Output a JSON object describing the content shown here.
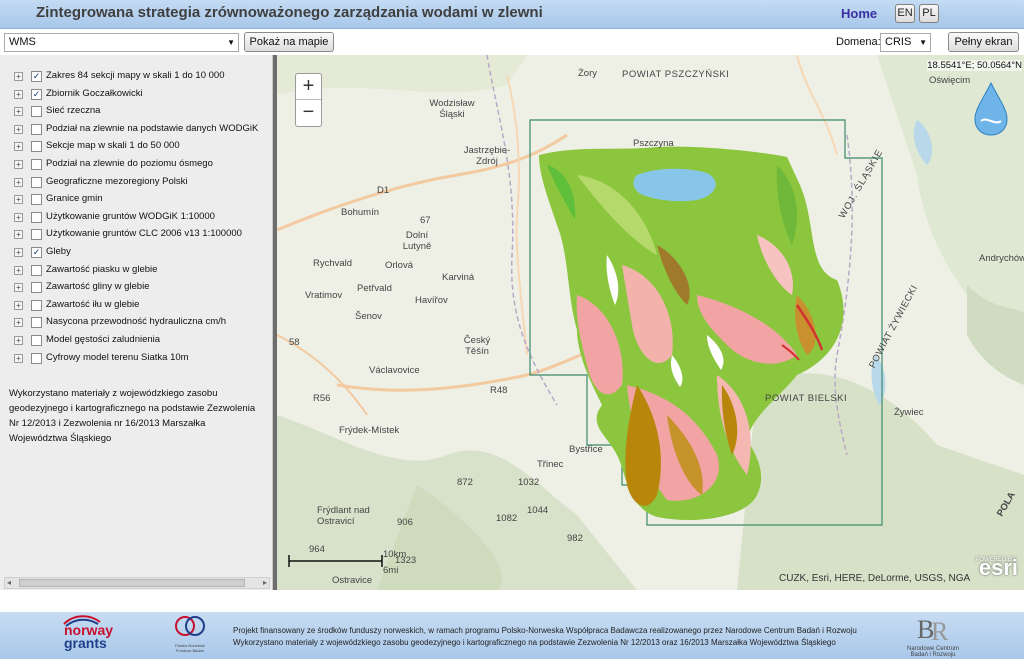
{
  "header": {
    "title": "Zintegrowana strategia zrównoważonego zarządzania wodami w zlewni",
    "home_label": "Home",
    "lang_en": "EN",
    "lang_pl": "PL"
  },
  "toolbar": {
    "service_select": "WMS",
    "show_on_map": "Pokaż na mapie",
    "domain_label": "Domena:",
    "domain_select": "CRIS",
    "fullscreen": "Pełny ekran"
  },
  "layers": [
    {
      "label": "Zakres 84 sekcji mapy w skali 1 do 10 000",
      "checked": true
    },
    {
      "label": "Zbiornik Goczałkowicki",
      "checked": true
    },
    {
      "label": "Sieć rzeczna",
      "checked": false
    },
    {
      "label": "Podział na zlewnie na podstawie danych WODGiK",
      "checked": false
    },
    {
      "label": "Sekcje map w skali 1 do 50 000",
      "checked": false
    },
    {
      "label": "Podział na zlewnie do poziomu ósmego",
      "checked": false
    },
    {
      "label": "Geograficzne mezoregiony Polski",
      "checked": false
    },
    {
      "label": "Granice gmin",
      "checked": false
    },
    {
      "label": "Użytkowanie gruntów WODGiK 1:10000",
      "checked": false
    },
    {
      "label": "Użytkowanie gruntów CLC 2006 v13 1:100000",
      "checked": false
    },
    {
      "label": "Gleby",
      "checked": true
    },
    {
      "label": "Zawartość piasku w glebie",
      "checked": false
    },
    {
      "label": "Zawartość gliny w glebie",
      "checked": false
    },
    {
      "label": "Zawartość iłu w glebie",
      "checked": false
    },
    {
      "label": "Nasycona przewodność hydrauliczna cm/h",
      "checked": false
    },
    {
      "label": "Model gęstości zaludnienia",
      "checked": false
    },
    {
      "label": "Cyfrowy model terenu Siatka 10m",
      "checked": false
    }
  ],
  "sidebar": {
    "credit": "Wykorzystano materiały z wojewódzkiego zasobu geodezyjnego i kartograficznego na podstawie Zezwolenia Nr 12/2013 i Zezwolenia nr 16/2013 Marszałka Województwa Śląskiego"
  },
  "map": {
    "coords": "18.5541°E; 50.0564°N",
    "zoom_in": "+",
    "zoom_out": "−",
    "attribution": "CUZK, Esri, HERE, DeLorme, USGS, NGA",
    "esri": "esri",
    "powered_by": "POWERED BY",
    "scale_km": "10km",
    "scale_mi": "6mi",
    "places": [
      "Żory",
      "POWIAT PSZCZYŃSKI",
      "Oświęcim",
      "Wodzisław Śląski",
      "Jastrzębie-Zdrój",
      "Pszczyna",
      "Bohumín",
      "Dolní Lutyně",
      "Rychvald",
      "Orlová",
      "Karviná",
      "Petřvald",
      "Havířov",
      "Vratimov",
      "Šenov",
      "Český Těšín",
      "Václavovice",
      "Frýdek-Místek",
      "Bystřice",
      "Třinec",
      "Frýdlant nad Ostravicí",
      "Żywiec",
      "POWIAT BIELSKI",
      "WOJ. ŚLĄSKIE",
      "POWIAT ŻYWIECKI",
      "Andrychów",
      "Ostravice",
      "R48",
      "R56",
      "D1",
      "67",
      "58",
      "872",
      "1032",
      "1082",
      "1044",
      "982",
      "906",
      "964",
      "1323",
      "POLA"
    ]
  },
  "footer": {
    "norway_line1": "norway",
    "norway_line2": "grants",
    "partner_label": "Polsko-Norweski Fundusz Badań",
    "ncbr_label": "Narodowe Centrum Badań i Rozwoju",
    "text_line1": "Projekt finansowany ze środków funduszy norweskich, w ramach programu Polsko-Norweska Współpraca Badawcza realizowanego przez Narodowe Centrum Badań i Rozwoju",
    "text_line2": "Wykorzystano materiały z wojewódzkiego zasobu geodezyjnego i kartograficznego na podstawie Zezwolenia Nr 12/2013 oraz 16/2013 Marszałka Województwa Śląskiego"
  },
  "colors": {
    "header_bg": "#b6d1ef",
    "home_text": "#3a2fa0",
    "soil_green": "#8cc63f",
    "soil_pink": "#f2a3a3",
    "soil_brown": "#b8860b",
    "reservoir": "#87c6e8",
    "boundary": "#3c8a6a"
  }
}
